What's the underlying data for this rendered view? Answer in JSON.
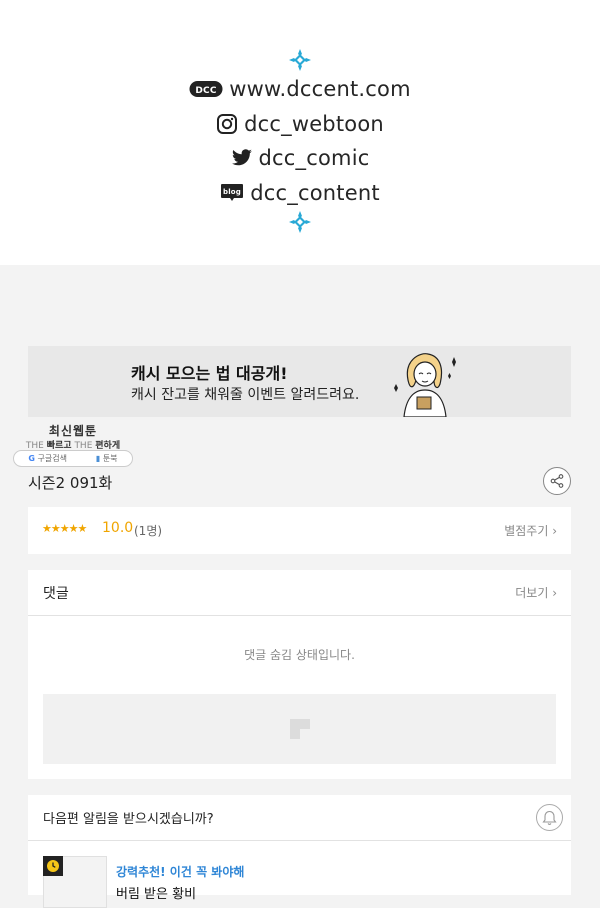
{
  "social": {
    "website": "www.dccent.com",
    "instagram": "dcc_webtoon",
    "twitter": "dcc_comic",
    "blog": "dcc_content",
    "blog_icon_text": "blog"
  },
  "banner": {
    "headline": "캐시 모으는 법 대공개!",
    "subline": "캐시 잔고를 채워줄 이벤트 알려드려요."
  },
  "ad": {
    "title": "최신웹툰",
    "tagline_prefix": "THE",
    "tagline_fast": "빠르고",
    "tagline_prefix2": "THE",
    "tagline_easy": "편하게",
    "search_label": "구글검색",
    "site_label": "툰북"
  },
  "episode": {
    "title": "시즌2 091화"
  },
  "rating": {
    "stars": "★★★★★",
    "score": "10.0",
    "count": "(1명)",
    "rate_link": "별점주기 ›"
  },
  "comments": {
    "title": "댓글",
    "more_link": "더보기 ›",
    "hidden_message": "댓글 숨김 상태입니다."
  },
  "notify": {
    "question": "다음편 알림을 받으시겠습니까?",
    "recommend_tag": "강력추천! 이건 꼭 봐야해",
    "recommend_title": "버림 받은 황비"
  },
  "colors": {
    "accent_cyan": "#29a9d6",
    "star": "#f0a500",
    "recommend_blue": "#2f86d6"
  }
}
